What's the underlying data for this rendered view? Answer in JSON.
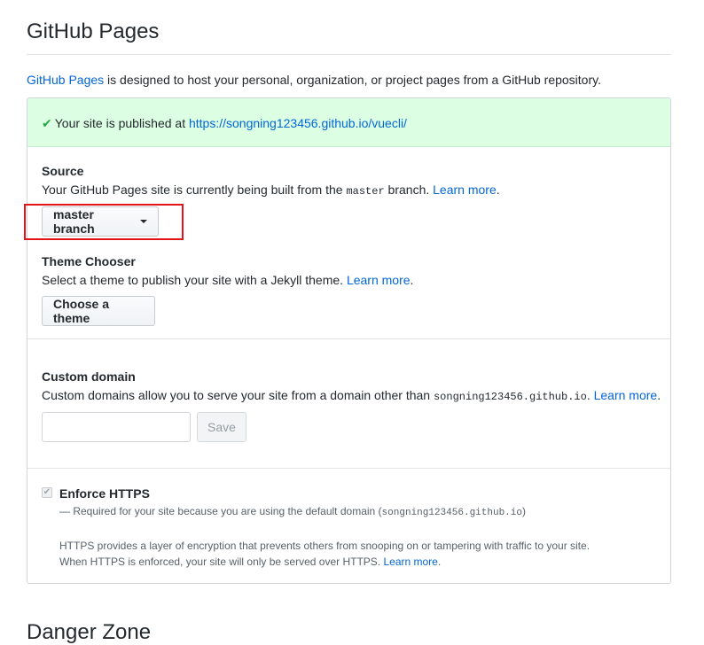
{
  "page": {
    "title": "GitHub Pages",
    "intro_link": "GitHub Pages",
    "intro_text": " is designed to host your personal, organization, or project pages from a GitHub repository.",
    "next_section_partial": "Danger Zone"
  },
  "status": {
    "text": "Your site is published at ",
    "url": "https://songning123456.github.io/vuecli/"
  },
  "source": {
    "label": "Source",
    "desc_before": "Your GitHub Pages site is currently being built from the ",
    "branch_code": "master",
    "desc_after": " branch. ",
    "learn_more": "Learn more",
    "period": ".",
    "dropdown_label": "master branch"
  },
  "theme": {
    "label": "Theme Chooser",
    "desc": "Select a theme to publish your site with a Jekyll theme. ",
    "learn_more": "Learn more",
    "period": ".",
    "button_label": "Choose a theme"
  },
  "custom_domain": {
    "label": "Custom domain",
    "desc": "Custom domains allow you to serve your site from a domain other than ",
    "domain_code": "songning123456.github.io",
    "period_space": ". ",
    "learn_more": "Learn more",
    "period": ".",
    "input_value": "",
    "save_label": "Save"
  },
  "https": {
    "label": "Enforce HTTPS",
    "note_before": "— Required for your site because you are using the default domain (",
    "note_code": "songning123456.github.io",
    "note_after": ")",
    "info_line1": "HTTPS provides a layer of encryption that prevents others from snooping on or tampering with traffic to your site.",
    "info_line2": "When HTTPS is enforced, your site will only be served over HTTPS. ",
    "learn_more": "Learn more",
    "period": "."
  },
  "colors": {
    "accent_link": "#0366d6",
    "success_bg": "#dcffe4",
    "highlight_red": "#e3131a"
  },
  "icons": {
    "status": "check-icon",
    "dropdown": "caret-down-icon"
  }
}
